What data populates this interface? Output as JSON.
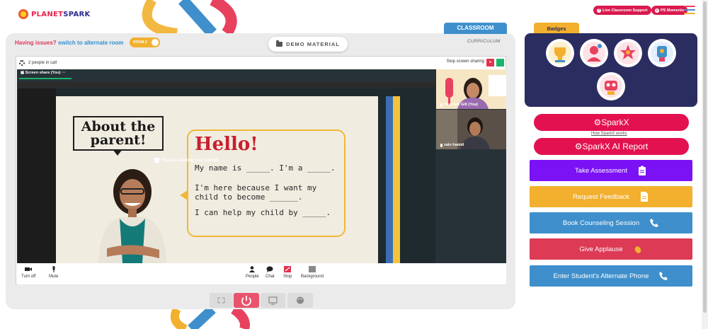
{
  "brand": {
    "logo_text_a": "PLANET",
    "logo_text_b": "SPARK"
  },
  "header": {
    "live_support_label": "Live Classroom Support",
    "moments_label": "PS Moments"
  },
  "room": {
    "issues_label": "Having issues?",
    "alternate_link": "switch to alternate room",
    "room_toggle_label": "ROOM 2",
    "demo_material_label": "DEMO MATERIAL",
    "classroom_tab": "CLASSROOM",
    "curriculum_tab": "CURRICULUM"
  },
  "call": {
    "people_count": "2 people in call",
    "stop_screen_sharing": "Stop screen sharing",
    "screen_share_label": "Screen share (You)",
    "sharing_notice": "You are sharing your screen",
    "participants": [
      {
        "name": "Yasmine Gill (You)"
      },
      {
        "name": "zain hamid"
      }
    ],
    "controls": {
      "turn_off": "Turn off",
      "mute": "Mute",
      "people": "People",
      "chat": "Chat",
      "stop": "Stop",
      "background": "Background"
    }
  },
  "slide": {
    "heading": "About the parent!",
    "hello": "Hello!",
    "line1": "My name is _____. I'm a _____.",
    "line2a": "I'm here because I want my",
    "line2b": "child to become ______.",
    "line3": "I can help my child by _____."
  },
  "sidebar": {
    "badges_title": "Badges",
    "sparkx_label": "SparkX",
    "how_sparkx": "How SparkX works",
    "sparkx_ai_label": "SparkX AI Report",
    "actions": [
      {
        "label": "Take Assessment",
        "color": "#7b11f5",
        "icon": "clipboard-icon"
      },
      {
        "label": "Request Feedback",
        "color": "#f2b02e",
        "icon": "document-icon"
      },
      {
        "label": "Book Counseling Session",
        "color": "#3e8fcb",
        "icon": "phone-icon"
      },
      {
        "label": "Give Applause",
        "color": "#dc3a55",
        "icon": "applause-icon"
      },
      {
        "label": "Enter Student's Alternate Phone",
        "color": "#3e8fcb",
        "icon": "phone-icon"
      }
    ]
  },
  "colors": {
    "brand_red": "#e3114f",
    "room_bg": "#ebebeb",
    "badges_bg": "#2b2c5f",
    "classroom_blue": "#3e8fcb",
    "accent_yellow": "#f2b02e"
  }
}
